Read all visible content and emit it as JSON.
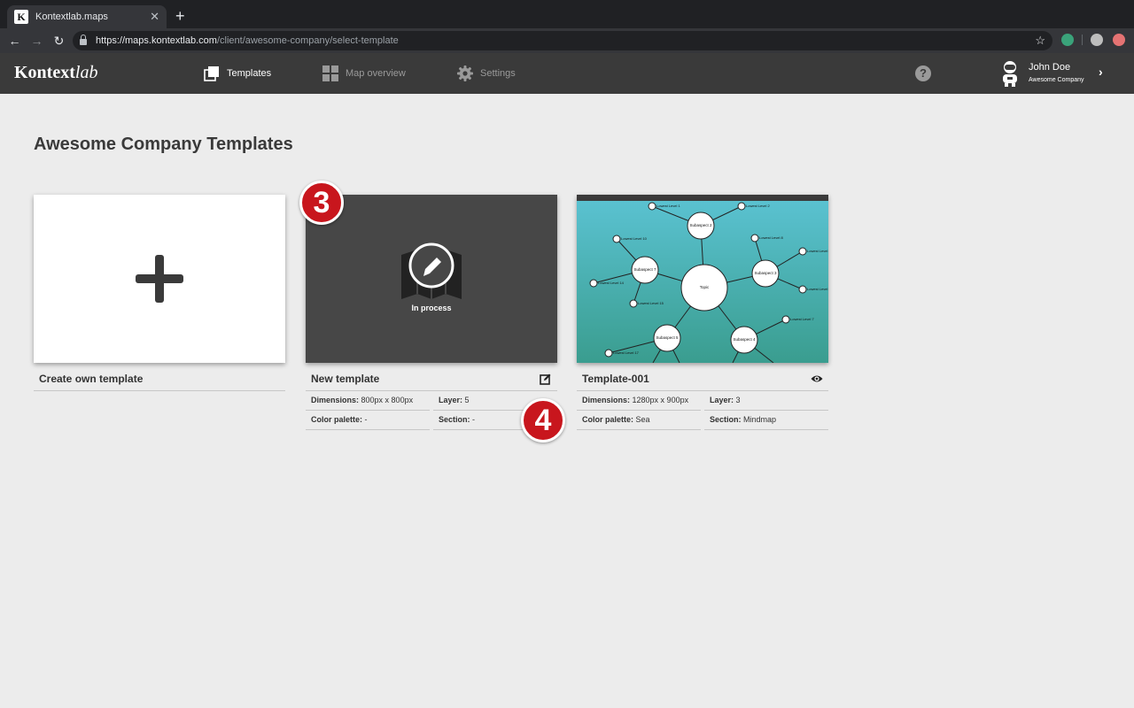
{
  "browser": {
    "tab_title": "Kontextlab.maps",
    "favicon_letter": "K",
    "url_host": "https://maps.kontextlab.com",
    "url_path": "/client/awesome-company/select-template"
  },
  "app": {
    "logo_main": "Kontext",
    "logo_italic": "lab",
    "nav": [
      {
        "label": "Templates",
        "icon": "templates-icon",
        "active": true
      },
      {
        "label": "Map overview",
        "icon": "grid-icon",
        "active": false
      },
      {
        "label": "Settings",
        "icon": "gear-icon",
        "active": false
      }
    ],
    "user": {
      "name": "John Doe",
      "company": "Awesome Company"
    }
  },
  "page": {
    "title": "Awesome Company Templates"
  },
  "cards": {
    "create": {
      "label": "Create own template"
    },
    "new": {
      "name": "New template",
      "status": "In process",
      "dimensions_label": "Dimensions:",
      "dimensions_value": "800px x 800px",
      "layer_label": "Layer:",
      "layer_value": "5",
      "palette_label": "Color palette:",
      "palette_value": "-",
      "section_label": "Section:",
      "section_value": "-"
    },
    "template001": {
      "name": "Template-001",
      "dimensions_label": "Dimensions:",
      "dimensions_value": "1280px x 900px",
      "layer_label": "Layer:",
      "layer_value": "3",
      "palette_label": "Color palette:",
      "palette_value": "Sea",
      "section_label": "Section:",
      "section_value": "Mindmap",
      "mindmap": {
        "topic": "Topic",
        "subaspects": [
          "Subaspect 2",
          "Subaspect 7",
          "Subaspect 3",
          "Subaspect 5",
          "Subaspect 4"
        ],
        "leaves": [
          "Lowest Level 1",
          "Lowest Level 2",
          "Lowest Level 10",
          "Lowest Level 8",
          "Lowest Level",
          "Lowest Level 14",
          "Lowest Level 15",
          "Lowest Level",
          "Lowest Level 7",
          "Lowest Level 17"
        ]
      }
    }
  },
  "annotations": [
    "3",
    "4"
  ],
  "colors": {
    "appbar": "#3a3a3a",
    "page_bg": "#ececec",
    "badge": "#c8161d",
    "sea_top": "#5bc3d3",
    "sea_bottom": "#3a9d8f"
  }
}
